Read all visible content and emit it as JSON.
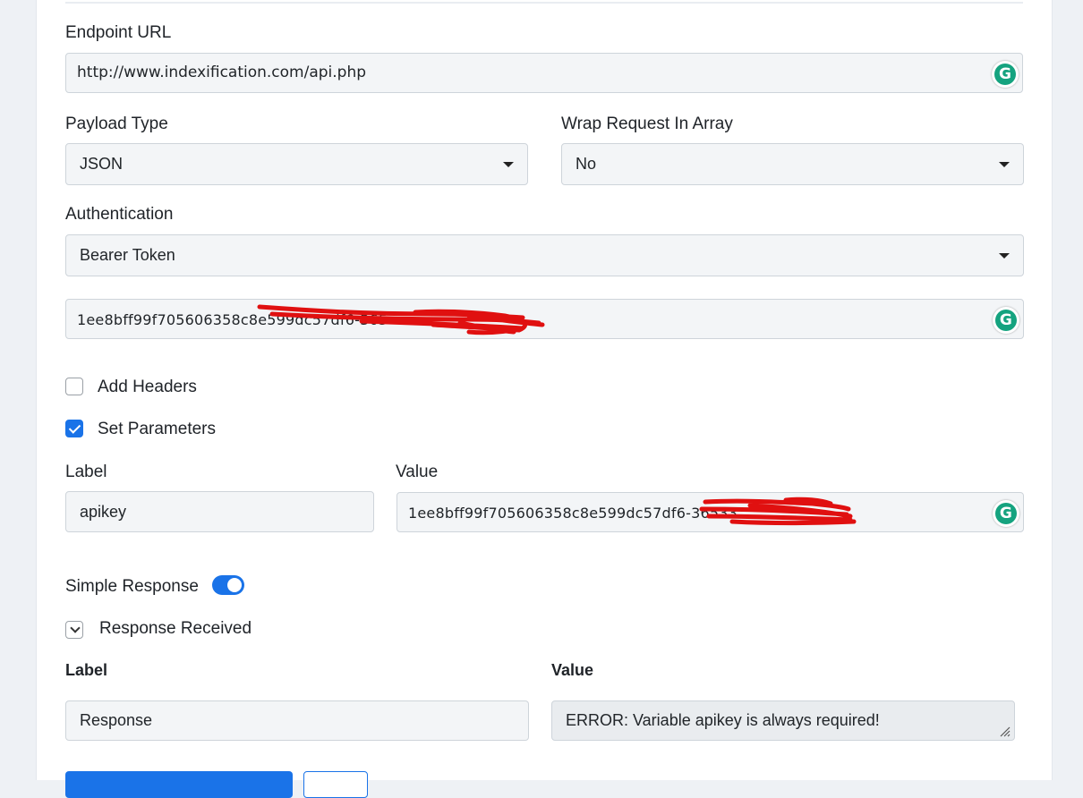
{
  "endpoint": {
    "label": "Endpoint URL",
    "value": "http://www.indexification.com/api.php"
  },
  "payload_type": {
    "label": "Payload Type",
    "value": "JSON"
  },
  "wrap_request": {
    "label": "Wrap Request In Array",
    "value": "No"
  },
  "authentication": {
    "label": "Authentication",
    "value": "Bearer Token",
    "token_value": "1ee8bff99f705606358c8e599dc57df6-365"
  },
  "grammarly": {
    "glyph": "G",
    "color": "#15a37f"
  },
  "add_headers": {
    "label": "Add Headers",
    "checked": false
  },
  "set_parameters": {
    "label": "Set Parameters",
    "checked": true
  },
  "parameters": {
    "label_header": "Label",
    "value_header": "Value",
    "row": {
      "label": "apikey",
      "value": "1ee8bff99f705606358c8e599dc57df6-36533"
    }
  },
  "simple_response": {
    "label": "Simple Response",
    "enabled": true
  },
  "response_received": {
    "label": "Response Received",
    "label_header": "Label",
    "value_header": "Value",
    "row": {
      "label": "Response",
      "value": "ERROR: Variable apikey is always required!"
    }
  },
  "colors": {
    "accent": "#1a73e8",
    "redaction": "#e01010"
  }
}
